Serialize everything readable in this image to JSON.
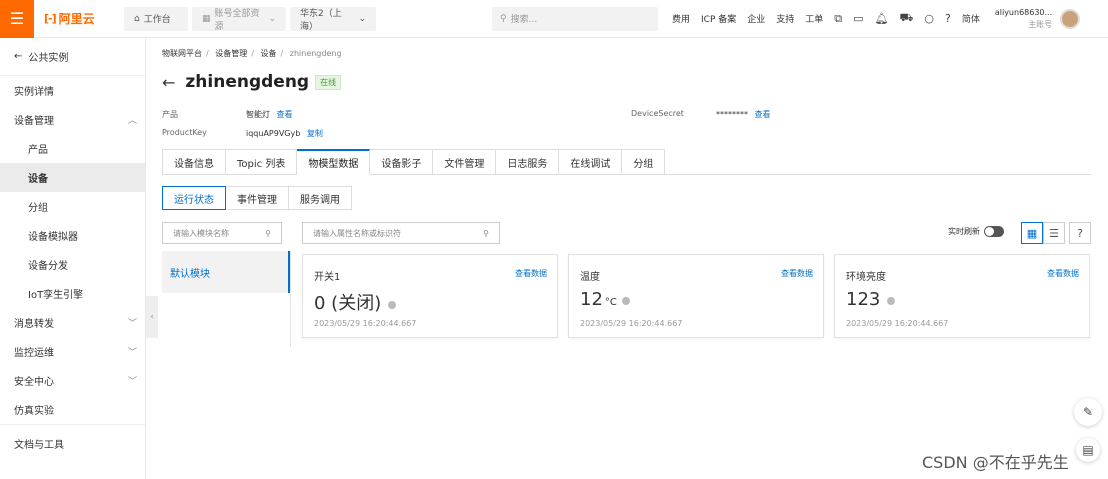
{
  "topbar": {
    "menu_icon": "menu-icon",
    "logo_mark": "[-]",
    "logo_text": "阿里云",
    "workspace": "工作台",
    "resources": "账号全部资源",
    "region": "华东2（上海）",
    "search_placeholder": "搜索...",
    "links": [
      "费用",
      "ICP 备案",
      "企业",
      "支持",
      "工单"
    ],
    "lang": "简体",
    "user_name": "aliyun68630...",
    "user_role": "主账号"
  },
  "sidebar": {
    "back_label": "公共实例",
    "items": [
      {
        "label": "实例详情"
      },
      {
        "label": "设备管理",
        "chevron": "up"
      },
      {
        "label": "产品"
      },
      {
        "label": "设备"
      },
      {
        "label": "分组"
      },
      {
        "label": "设备模拟器"
      },
      {
        "label": "设备分发"
      },
      {
        "label": "IoT孪生引擎"
      },
      {
        "label": "消息转发"
      },
      {
        "label": "监控运维"
      },
      {
        "label": "安全中心"
      },
      {
        "label": "仿真实验"
      },
      {
        "label": "文档与工具"
      }
    ]
  },
  "breadcrumb": [
    "物联网平台",
    "设备管理",
    "设备",
    "zhinengdeng"
  ],
  "device": {
    "name": "zhinengdeng",
    "status": "在线",
    "product_label": "产品",
    "product_value": "智能灯",
    "product_link": "查看",
    "productkey_label": "ProductKey",
    "productkey_value": "iqquAP9VGyb",
    "productkey_link": "复制",
    "secret_label": "DeviceSecret",
    "secret_value": "********",
    "secret_link": "查看"
  },
  "tabs": [
    "设备信息",
    "Topic 列表",
    "物模型数据",
    "设备影子",
    "文件管理",
    "日志服务",
    "在线调试",
    "分组"
  ],
  "active_tab": "物模型数据",
  "subtabs": [
    "运行状态",
    "事件管理",
    "服务调用"
  ],
  "module_search_placeholder": "请输入模块名称",
  "attr_search_placeholder": "请输入属性名称或标识符",
  "module_default": "默认模块",
  "realtime_label": "实时刷新",
  "help_label": "?",
  "cards": [
    {
      "title": "开关1",
      "link": "查看数据",
      "value": "0 (关闭)",
      "unit": "",
      "time": "2023/05/29 16:20:44.667"
    },
    {
      "title": "温度",
      "link": "查看数据",
      "value": "12",
      "unit": "°C",
      "time": "2023/05/29 16:20:44.667"
    },
    {
      "title": "环境亮度",
      "link": "查看数据",
      "value": "123",
      "unit": "",
      "time": "2023/05/29 16:20:44.667"
    }
  ],
  "watermark": "CSDN @不在乎先生",
  "colors": {
    "brand": "#ff6a00",
    "link": "#0070cc"
  }
}
